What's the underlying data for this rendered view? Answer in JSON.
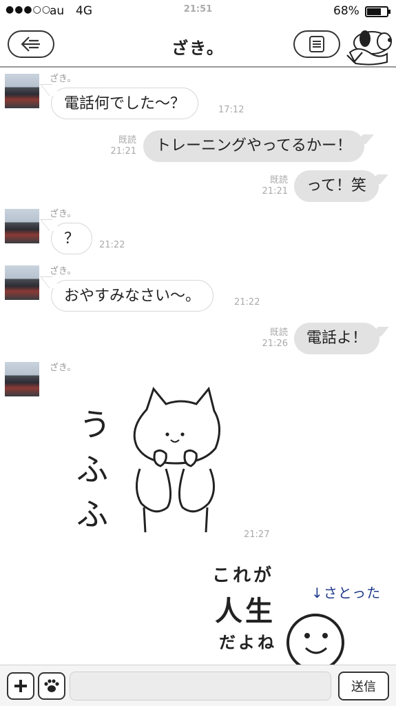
{
  "status_bar": {
    "signal": "●●●○○",
    "carrier": "au",
    "network": "4G",
    "time": "21:51",
    "battery_pct": "68%",
    "battery_level": 0.68
  },
  "header": {
    "title": "ざき。"
  },
  "messages": [
    {
      "dir": "in",
      "sender": "ざき。",
      "text": "電話何でした〜？",
      "time": "17:12"
    },
    {
      "dir": "out",
      "read": "既読",
      "text": "トレーニングやってるかー！",
      "time": "21:21"
    },
    {
      "dir": "out",
      "read": "既読",
      "text": "って！笑",
      "time": "21:21"
    },
    {
      "dir": "in",
      "sender": "ざき。",
      "text": "？",
      "time": "21:22"
    },
    {
      "dir": "in",
      "sender": "ざき。",
      "text": "おやすみなさい〜。",
      "time": "21:22"
    },
    {
      "dir": "out",
      "read": "既読",
      "text": "電話よ！",
      "time": "21:26"
    },
    {
      "dir": "in",
      "sender": "ざき。",
      "sticker": "cat",
      "time": "21:27"
    }
  ],
  "stickers": {
    "cat_text": [
      "う",
      "ふ",
      "ふ"
    ],
    "life_text_1": "これが",
    "life_text_2": "人生",
    "life_text_3": "だよね",
    "life_note": "↓さとった"
  },
  "input_bar": {
    "placeholder": "",
    "send_label": "送信"
  }
}
